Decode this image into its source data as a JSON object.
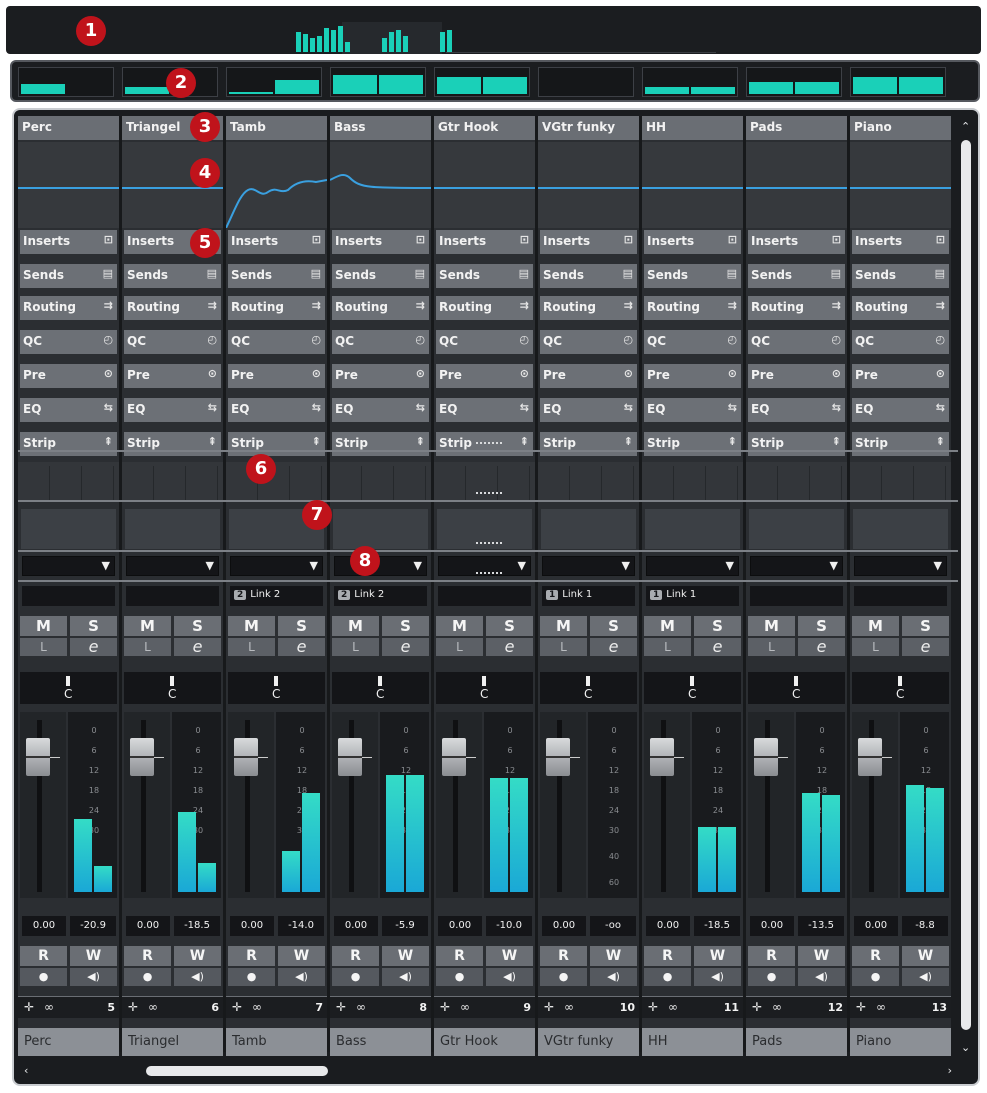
{
  "callouts": [
    "1",
    "2",
    "3",
    "4",
    "5",
    "6",
    "7",
    "8"
  ],
  "sections": [
    "Inserts",
    "Sends",
    "Routing",
    "QC",
    "Pre",
    "EQ",
    "Strip"
  ],
  "section_icons": [
    "inserts-icon",
    "sends-icon",
    "routing-icon",
    "quick-controls-icon",
    "pre-icon",
    "eq-icon",
    "strip-icon"
  ],
  "section_icon_glyphs": [
    "⊡",
    "▤",
    "⇉",
    "◴",
    "⊙",
    "⇆",
    "⇞"
  ],
  "buttons": {
    "mute": "M",
    "solo": "S",
    "listen": "L",
    "edit": "e",
    "read": "R",
    "write": "W",
    "record_glyph": "●",
    "monitor_glyph": "◀)"
  },
  "pan_label": "C",
  "meter_scale": [
    "0",
    "6",
    "12",
    "18",
    "24",
    "30",
    "40",
    "60"
  ],
  "accent_color": "#1ad0b8",
  "overview_bars": [
    20,
    18,
    14,
    16,
    24,
    22,
    26,
    10,
    14,
    20,
    22,
    16,
    20,
    22
  ],
  "rack_levels": [
    [
      0.4,
      0.0
    ],
    [
      0.3,
      0.0
    ],
    [
      0.1,
      0.6
    ],
    [
      0.8,
      0.8
    ],
    [
      0.7,
      0.7
    ],
    [
      0.0,
      0.0
    ],
    [
      0.3,
      0.3
    ],
    [
      0.5,
      0.5
    ],
    [
      0.7,
      0.7
    ]
  ],
  "channels": [
    {
      "name": "Perc",
      "number": "5",
      "fader": "0.00",
      "peak": "-20.9",
      "link": "",
      "link_num": "",
      "meter_left": 0.43,
      "meter_right": 0.15
    },
    {
      "name": "Triangel",
      "number": "6",
      "fader": "0.00",
      "peak": "-18.5",
      "link": "",
      "link_num": "",
      "meter_left": 0.47,
      "meter_right": 0.17
    },
    {
      "name": "Tamb",
      "number": "7",
      "fader": "0.00",
      "peak": "-14.0",
      "link": "Link 2",
      "link_num": "2",
      "meter_left": 0.24,
      "meter_right": 0.58
    },
    {
      "name": "Bass",
      "number": "8",
      "fader": "0.00",
      "peak": "-5.9",
      "link": "Link 2",
      "link_num": "2",
      "meter_left": 0.69,
      "meter_right": 0.69
    },
    {
      "name": "Gtr Hook",
      "number": "9",
      "fader": "0.00",
      "peak": "-10.0",
      "link": "",
      "link_num": "",
      "meter_left": 0.67,
      "meter_right": 0.67
    },
    {
      "name": "VGtr funky",
      "number": "10",
      "fader": "0.00",
      "peak": "-oo",
      "link": "Link 1",
      "link_num": "1",
      "meter_left": 0.0,
      "meter_right": 0.0
    },
    {
      "name": "HH",
      "number": "11",
      "fader": "0.00",
      "peak": "-18.5",
      "link": "Link 1",
      "link_num": "1",
      "meter_left": 0.38,
      "meter_right": 0.38
    },
    {
      "name": "Pads",
      "number": "12",
      "fader": "0.00",
      "peak": "-13.5",
      "link": "",
      "link_num": "",
      "meter_left": 0.58,
      "meter_right": 0.57
    },
    {
      "name": "Piano",
      "number": "13",
      "fader": "0.00",
      "peak": "-8.8",
      "link": "",
      "link_num": "",
      "meter_left": 0.63,
      "meter_right": 0.61
    }
  ]
}
